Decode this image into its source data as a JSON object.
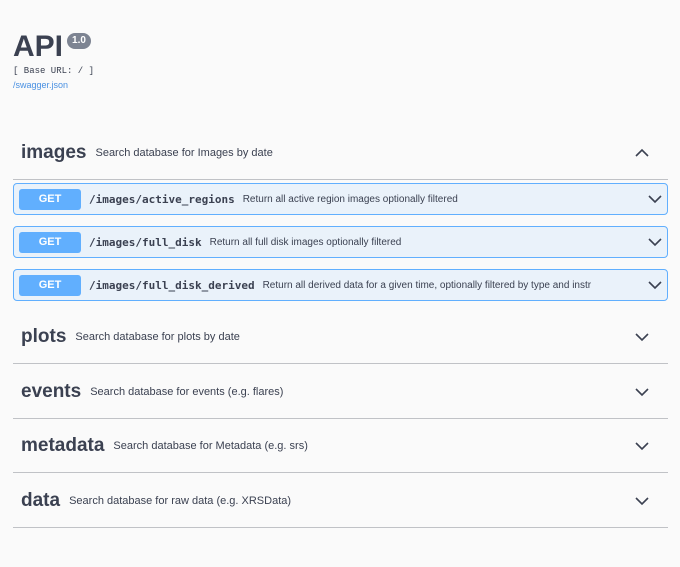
{
  "info": {
    "title": "API",
    "version": "1.0",
    "base_url": "[ Base URL: / ]",
    "spec_link": "/swagger.json"
  },
  "tags": [
    {
      "name": "images",
      "description": "Search database for Images by date",
      "expanded": true,
      "operations": [
        {
          "method": "GET",
          "path": "/images/active_regions",
          "summary": "Return all active region images optionally filtered"
        },
        {
          "method": "GET",
          "path": "/images/full_disk",
          "summary": "Return all full disk images optionally filtered"
        },
        {
          "method": "GET",
          "path": "/images/full_disk_derived",
          "summary": "Return all derived data for a given time, optionally filtered by type and instr"
        }
      ]
    },
    {
      "name": "plots",
      "description": "Search database for plots by date",
      "expanded": false
    },
    {
      "name": "events",
      "description": "Search database for events (e.g. flares)",
      "expanded": false
    },
    {
      "name": "metadata",
      "description": "Search database for Metadata (e.g. srs)",
      "expanded": false
    },
    {
      "name": "data",
      "description": "Search database for raw data (e.g. XRSData)",
      "expanded": false
    }
  ],
  "colors": {
    "get_accent": "#61affe",
    "text": "#3b4151",
    "link": "#4990e2"
  },
  "icons": {
    "expanded": "chevron-up-icon",
    "collapsed": "chevron-down-icon"
  }
}
